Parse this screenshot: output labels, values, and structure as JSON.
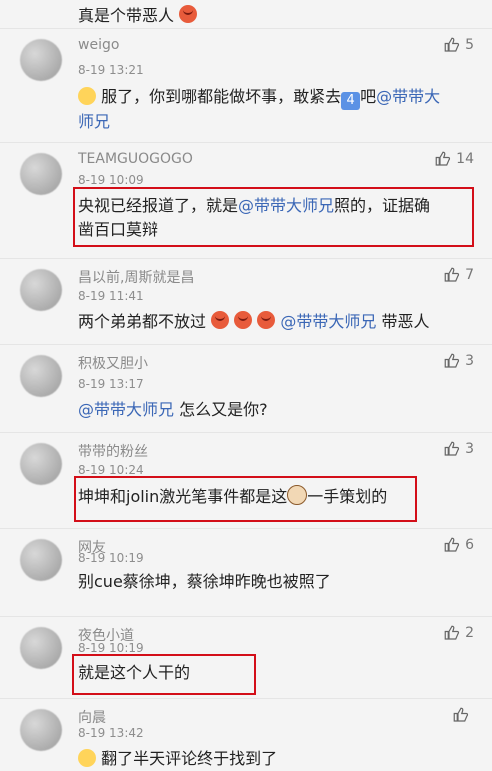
{
  "top_text": "真是个带恶人",
  "comments": [
    {
      "username": "weigo",
      "timestamp": "8-19 13:21",
      "likes": "5",
      "text": [
        "服了，你到哪都能做坏事，敢紧去",
        "吧",
        "@带带大",
        "师兄"
      ]
    },
    {
      "username": "TEAMGUOGOGO",
      "timestamp": "8-19 10:09",
      "likes": "14",
      "text": [
        "央视已经报道了，就是",
        "@带带大师兄",
        "照的，证据确",
        "凿百口莫辩"
      ]
    },
    {
      "username": "昌以前,周斯就是昌",
      "timestamp": "8-19 11:41",
      "likes": "7",
      "text": [
        "两个弟弟都不放过",
        "@带带大师兄",
        "带恶人"
      ]
    },
    {
      "username": "积极又胆小",
      "timestamp": "8-19 13:17",
      "likes": "3",
      "text": [
        "@带带大师兄",
        "怎么又是你?"
      ]
    },
    {
      "username": "带带的粉丝",
      "timestamp": "8-19 10:24",
      "likes": "3",
      "text": [
        "坤坤和jolin激光笔事件都是这",
        "一手策划的"
      ]
    },
    {
      "username": "网友",
      "timestamp": "8-19 10:19",
      "likes": "6",
      "text": [
        "别cue蔡徐坤，蔡徐坤昨晚也被照了"
      ]
    },
    {
      "username": "夜色小道",
      "timestamp": "8-19 10:19",
      "likes": "2",
      "text": [
        "就是这个人干的"
      ]
    },
    {
      "username": "向晨",
      "timestamp": "8-19 13:42",
      "likes": "",
      "text": [
        "翻了半天评论终于找到了"
      ]
    }
  ],
  "icons": {
    "like": "thumbs-up-icon",
    "emoji_angry": "angry-face-icon",
    "emoji_four": "number-four-icon",
    "emoji_dog": "dog-face-icon",
    "emoji_smile": "smile-face-icon"
  },
  "colors": {
    "link": "#3b67b6",
    "highlight": "#d30e18"
  }
}
